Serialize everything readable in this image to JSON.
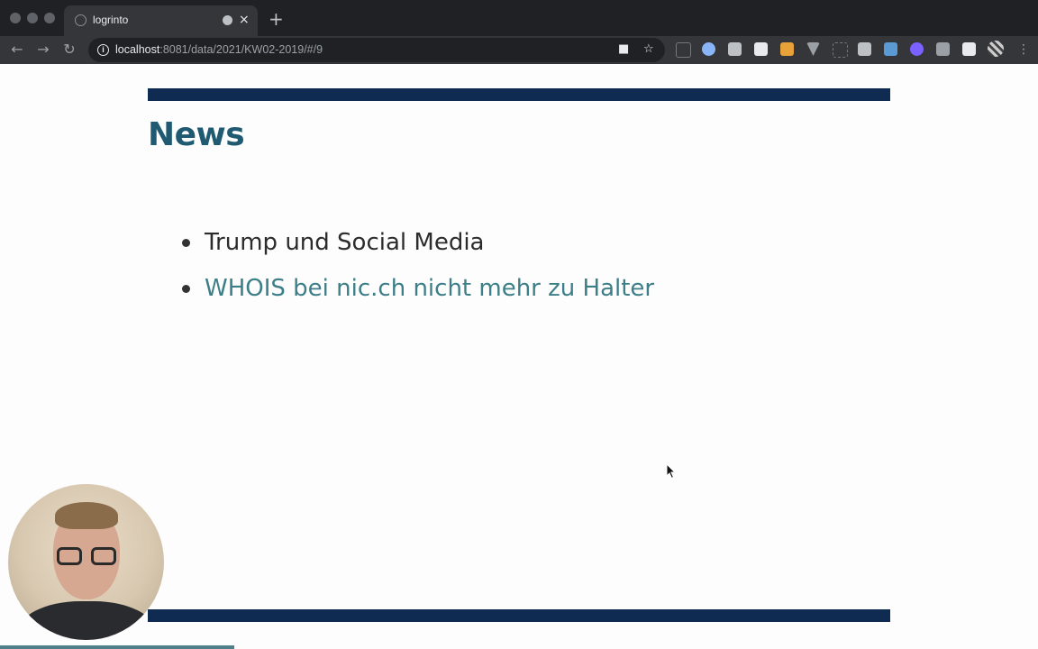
{
  "browser": {
    "tab": {
      "title": "logrinto",
      "close_label": "×",
      "new_tab_label": "+"
    },
    "address": {
      "host": "localhost",
      "path": ":8081/data/2021/KW02-2019/#/9"
    }
  },
  "slide": {
    "heading": "News",
    "items": [
      {
        "text": "Trump und Social Media",
        "is_link": false
      },
      {
        "text": "WHOIS bei nic.ch nicht mehr zu Halter",
        "is_link": true
      }
    ]
  },
  "colors": {
    "accent_bar": "#0f2b52",
    "heading": "#1f5a72",
    "link": "#3d7f88",
    "text": "#2c2c2c"
  },
  "icons": [
    "back-icon",
    "forward-icon",
    "reload-icon",
    "info-icon",
    "camera-icon",
    "star-icon",
    "extension-icons",
    "puzzle-icon",
    "menu-icon"
  ]
}
